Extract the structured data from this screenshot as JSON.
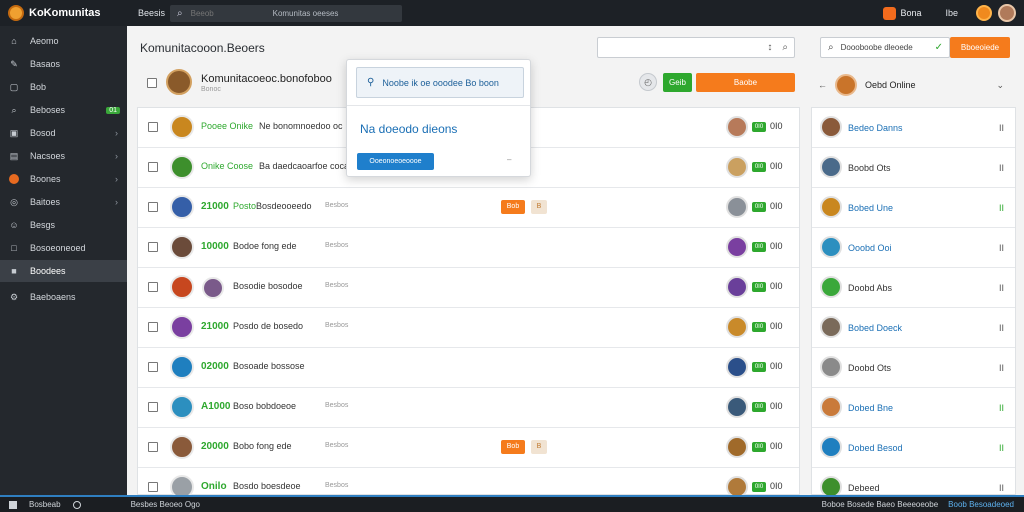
{
  "topbar": {
    "brand": "KoKomunitas",
    "link": "Beesis",
    "search_placeholder": "Beeob",
    "search_hint": "Komunitas oeeses",
    "user_label": "Bona",
    "bell": "Ibe"
  },
  "sidebar": {
    "items": [
      {
        "label": "Aeomo",
        "icon": "⌂",
        "chev": false
      },
      {
        "label": "Basaos",
        "icon": "✎",
        "chev": false
      },
      {
        "label": "Bob",
        "icon": "▢",
        "chev": false
      },
      {
        "label": "Beboses",
        "icon": "⌕",
        "badge": "01"
      },
      {
        "label": "Bosod",
        "icon": "▣",
        "chev": true
      },
      {
        "label": "Nacsoes",
        "icon": "▤",
        "chev": true
      },
      {
        "label": "Boones",
        "icon": "",
        "chev": true
      },
      {
        "label": "Baitoes",
        "icon": "◎",
        "chev": true
      },
      {
        "label": "Besgs",
        "icon": "☺",
        "chev": false
      },
      {
        "label": "Bosoeoneoed",
        "icon": "□",
        "chev": false
      },
      {
        "label": "Boodees",
        "icon": "■",
        "active": true
      },
      {
        "label": "Baeboaens",
        "icon": "⚙",
        "chev": false
      }
    ]
  },
  "main": {
    "title": "Komunitacooon.Beoers",
    "search_icons": [
      "↕",
      "⌕"
    ],
    "group": {
      "title": "Komunitacoeoc.bonofoboo",
      "subtitle": "Bonoc",
      "clock": "◴",
      "green_btn": "Geib",
      "orange_btn": "Baobe"
    },
    "rows": [
      {
        "num": "",
        "name": "Pooee Onike",
        "desc": "Ne bonomnoedoo oc",
        "small": "",
        "btn": false,
        "count": "0I0"
      },
      {
        "num": "",
        "name": "Onike Coose",
        "desc": "Ba daedcaoarfoe cocae",
        "small": "",
        "btn": false,
        "count": "0I0"
      },
      {
        "num": "21000",
        "name": "Posto",
        "desc": "Bosdeooeedo",
        "small": "Besbos",
        "btn": true,
        "count": "0I0"
      },
      {
        "num": "10000",
        "name": "",
        "desc": "Bodoe fong ede",
        "small": "Besbos",
        "btn": false,
        "count": "0I0"
      },
      {
        "num": "",
        "name": "",
        "desc": "Bosodie bosodoe",
        "small": "Besbos",
        "btn": false,
        "count": "0I0"
      },
      {
        "num": "21000",
        "name": "",
        "desc": "Posdo de bosedo",
        "small": "Besbos",
        "btn": false,
        "count": "0I0"
      },
      {
        "num": "02000",
        "name": "",
        "desc": "Bosoade bossose",
        "small": "",
        "btn": false,
        "count": "0I0"
      },
      {
        "num": "A1000",
        "name": "",
        "desc": "Boso bobdoeoe",
        "small": "Besbos",
        "btn": false,
        "count": "0I0"
      },
      {
        "num": "20000",
        "name": "",
        "desc": "Bobo fong ede",
        "small": "Besbos",
        "btn": true,
        "count": "0I0"
      },
      {
        "num": "Onilo",
        "name": "",
        "desc": "Bosdo boesdeoe",
        "small": "Besbos",
        "btn": false,
        "count": "0I0"
      }
    ],
    "row_btn_orange": "Bob",
    "row_btn_light": "B"
  },
  "popup": {
    "field": "Noobe ik oe ooodee Bo boon",
    "text": "Na doeodo dieons",
    "button": "Ooeonoeoeoooe",
    "minus": "–"
  },
  "right": {
    "search": "Doooboobe dleoede",
    "button": "Bboeoiede",
    "head": "Oebd Online",
    "items": [
      {
        "name": "Bedeo Danns",
        "style": "blue",
        "bars": "II",
        "green": false
      },
      {
        "name": "Boobd Ots",
        "style": "dark",
        "bars": "II",
        "green": false
      },
      {
        "name": "Bobed Une",
        "style": "blue",
        "bars": "II",
        "green": true
      },
      {
        "name": "Ooobd Ooi",
        "style": "blue",
        "bars": "II",
        "green": false
      },
      {
        "name": "Doobd Abs",
        "style": "dark",
        "bars": "II",
        "green": false
      },
      {
        "name": "Bobed Doeck",
        "style": "blue",
        "bars": "II",
        "green": false
      },
      {
        "name": "Doobd Ots",
        "style": "dark",
        "bars": "II",
        "green": false
      },
      {
        "name": "Dobed Bne",
        "style": "blue",
        "bars": "II",
        "green": true
      },
      {
        "name": "Dobed Besod",
        "style": "blue",
        "bars": "II",
        "green": true
      },
      {
        "name": "Debeed",
        "style": "dark",
        "bars": "II",
        "green": false
      }
    ]
  },
  "bottombar": {
    "left": "Bosbeab",
    "middle": "Besbes Beoeo Ogo",
    "right1": "Boboe Bosede Baeo Beeeoeobe",
    "right2": "Boob Besoadeoed"
  },
  "colors": {
    "accent_orange": "#f57b1c",
    "accent_green": "#2ea82e",
    "accent_blue": "#1f7fcc",
    "sidebar_bg": "#24282d"
  }
}
